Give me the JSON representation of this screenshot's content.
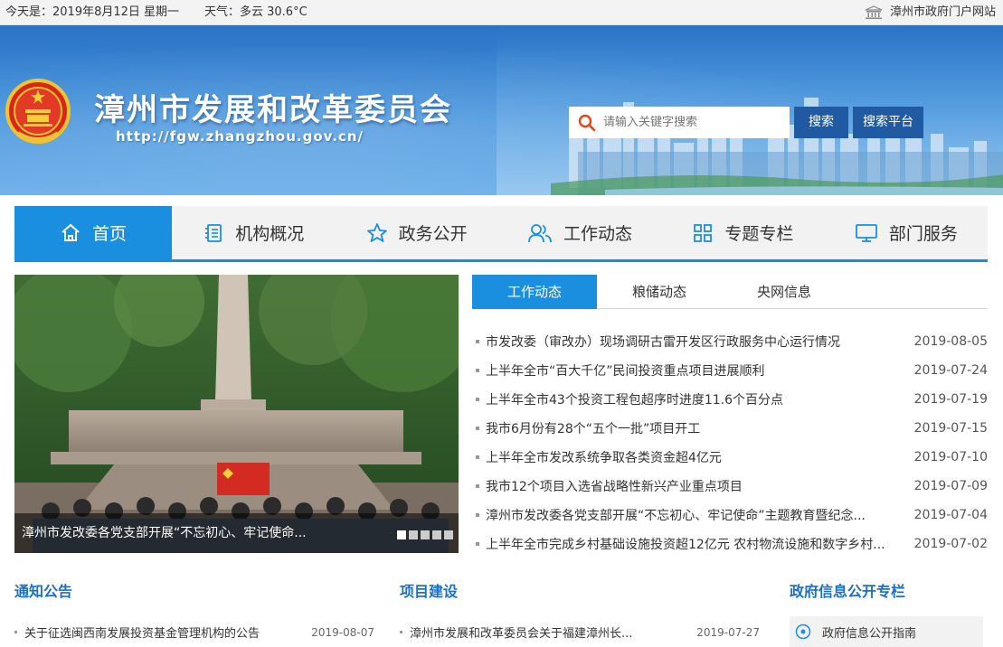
{
  "topbar": {
    "date_text": "今天是：2019年8月12日 星期一",
    "weather_text": "天气：多云 30.6°C",
    "portal_link": "漳州市政府门户网站",
    "portal_icon": "government-building-icon"
  },
  "header": {
    "emblem_icon": "national-emblem-icon",
    "site_title": "漳州市发展和改革委员会",
    "site_url": "http://fgw.zhangzhou.gov.cn/",
    "search_placeholder": "请输入关键字搜索",
    "search_button": "搜索",
    "platform_button": "搜索平台"
  },
  "nav": {
    "items": [
      {
        "label": "首页",
        "icon": "home-icon",
        "active": true
      },
      {
        "label": "机构概况",
        "icon": "document-list-icon",
        "active": false
      },
      {
        "label": "政务公开",
        "icon": "star-icon",
        "active": false
      },
      {
        "label": "工作动态",
        "icon": "users-icon",
        "active": false
      },
      {
        "label": "专题专栏",
        "icon": "grid-icon",
        "active": false
      },
      {
        "label": "部门服务",
        "icon": "monitor-icon",
        "active": false
      }
    ]
  },
  "slider": {
    "caption": "漳州市发改委各党支部开展“不忘初心、牢记使命...",
    "dot_count": 5,
    "active_dot": 1
  },
  "news": {
    "tabs": [
      "工作动态",
      "粮储动态",
      "央网信息"
    ],
    "active_tab": 0,
    "items": [
      {
        "title": "市发改委（审改办）现场调研古雷开发区行政服务中心运行情况",
        "date": "2019-08-05"
      },
      {
        "title": "上半年全市“百大千亿”民间投资重点项目进展顺利",
        "date": "2019-07-24"
      },
      {
        "title": "上半年全市43个投资工程包超序时进度11.6个百分点",
        "date": "2019-07-19"
      },
      {
        "title": "我市6月份有28个“五个一批”项目开工",
        "date": "2019-07-15"
      },
      {
        "title": "上半年全市发改系统争取各类资金超4亿元",
        "date": "2019-07-10"
      },
      {
        "title": "我市12个项目入选省战略性新兴产业重点项目",
        "date": "2019-07-09"
      },
      {
        "title": "漳州市发改委各党支部开展“不忘初心、牢记使命”主题教育暨纪念...",
        "date": "2019-07-04"
      },
      {
        "title": "上半年全市完成乡村基础设施投资超12亿元 农村物流设施和数字乡村...",
        "date": "2019-07-02"
      }
    ]
  },
  "notices": {
    "title": "通知公告",
    "items": [
      {
        "title": "关于征选闽西南发展投资基金管理机构的公告",
        "date": "2019-08-07"
      }
    ]
  },
  "projects": {
    "title": "项目建设",
    "items": [
      {
        "title": "漳州市发展和改革委员会关于福建漳州长...",
        "date": "2019-07-27"
      }
    ]
  },
  "govinfo": {
    "title": "政府信息公开专栏",
    "guide_label": "政府信息公开指南",
    "guide_icon": "compass-icon"
  },
  "colors": {
    "accent": "#1a8fe0",
    "banner": "#3f8ed9",
    "button": "#1f5aa3",
    "search_icon": "#e8431f"
  }
}
